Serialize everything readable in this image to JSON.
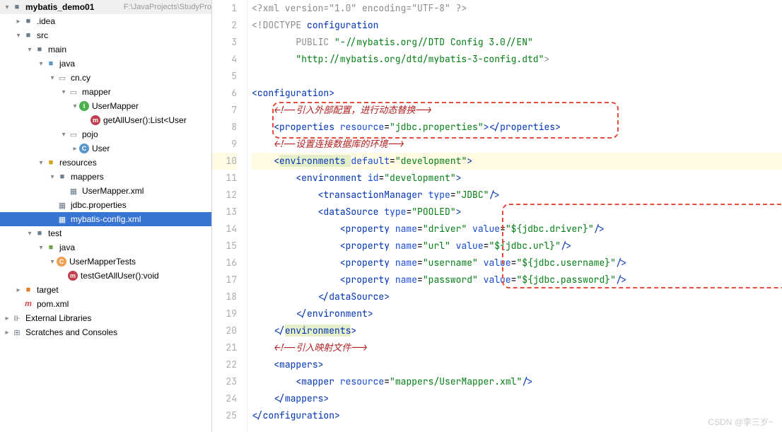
{
  "project": {
    "name": "mybatis_demo01",
    "path": "F:\\JavaProjects\\StudyPro"
  },
  "tree": {
    "idea": ".idea",
    "src": "src",
    "main": "main",
    "java_main": "java",
    "pkg_cn_cy": "cn.cy",
    "mapper": "mapper",
    "usermapper_if": "UserMapper",
    "getalluser": "getAllUser():List<User",
    "pojo": "pojo",
    "user_cls": "User",
    "resources": "resources",
    "mappers": "mappers",
    "usermapper_xml": "UserMapper.xml",
    "jdbc_props": "jdbc.properties",
    "mybatis_cfg": "mybatis-config.xml",
    "test": "test",
    "java_test": "java",
    "usermappertests": "UserMapperTests",
    "testgetalluser": "testGetAllUser():void",
    "target": "target",
    "pom": "pom.xml",
    "ext_libs": "External Libraries",
    "scratches": "Scratches and Consoles"
  },
  "code": {
    "l1": "<?xml version=\"1.0\" encoding=\"UTF-8\" ?>",
    "l2_a": "<!DOCTYPE ",
    "l2_b": "configuration",
    "l3_a": "PUBLIC ",
    "l3_b": "\"-//mybatis.org//DTD Config 3.0//EN\"",
    "l4_a": "\"http://mybatis.org/dtd/mybatis-3-config.dtd\"",
    "l4_b": ">",
    "l6_a": "<",
    "l6_b": "configuration",
    "l6_c": ">",
    "l7": "<!--引入外部配置，进行动态替换-->",
    "l8_a": "<",
    "l8_b": "properties ",
    "l8_c": "resource",
    "l8_d": "=",
    "l8_e": "\"jdbc.properties\"",
    "l8_f": "></",
    "l8_g": "properties",
    "l8_h": ">",
    "l9": "<!--设置连接数据库的环境-->",
    "l10_a": "<",
    "l10_b": "environments ",
    "l10_c": "default",
    "l10_d": "=",
    "l10_e": "\"development\"",
    "l10_f": ">",
    "l11_a": "<",
    "l11_b": "environment ",
    "l11_c": "id",
    "l11_d": "=",
    "l11_e": "\"development\"",
    "l11_f": ">",
    "l12_a": "<",
    "l12_b": "transactionManager ",
    "l12_c": "type",
    "l12_d": "=",
    "l12_e": "\"JDBC\"",
    "l12_f": "/>",
    "l13_a": "<",
    "l13_b": "dataSource ",
    "l13_c": "type",
    "l13_d": "=",
    "l13_e": "\"POOLED\"",
    "l13_f": ">",
    "l14_a": "<",
    "l14_b": "property ",
    "l14_c": "name",
    "l14_d": "=",
    "l14_e": "\"driver\" ",
    "l14_f": "value",
    "l14_g": "=",
    "l14_h": "\"${jdbc.driver}\"",
    "l14_i": "/>",
    "l15_a": "<",
    "l15_b": "property ",
    "l15_c": "name",
    "l15_d": "=",
    "l15_e": "\"url\" ",
    "l15_f": "value",
    "l15_g": "=",
    "l15_h": "\"${jdbc.url}\"",
    "l15_i": "/>",
    "l16_a": "<",
    "l16_b": "property ",
    "l16_c": "name",
    "l16_d": "=",
    "l16_e": "\"username\" ",
    "l16_f": "value",
    "l16_g": "=",
    "l16_h": "\"${jdbc.username}\"",
    "l16_i": "/>",
    "l17_a": "<",
    "l17_b": "property ",
    "l17_c": "name",
    "l17_d": "=",
    "l17_e": "\"password\" ",
    "l17_f": "value",
    "l17_g": "=",
    "l17_h": "\"${jdbc.password}\"",
    "l17_i": "/>",
    "l18_a": "</",
    "l18_b": "dataSource",
    "l18_c": ">",
    "l19_a": "</",
    "l19_b": "environment",
    "l19_c": ">",
    "l20_a": "</",
    "l20_b": "environments",
    "l20_c": ">",
    "l21": "<!--引入映射文件-->",
    "l22_a": "<",
    "l22_b": "mappers",
    "l22_c": ">",
    "l23_a": "<",
    "l23_b": "mapper ",
    "l23_c": "resource",
    "l23_d": "=",
    "l23_e": "\"mappers/UserMapper.xml\"",
    "l23_f": "/>",
    "l24_a": "</",
    "l24_b": "mappers",
    "l24_c": ">",
    "l25_a": "</",
    "l25_b": "configuration",
    "l25_c": ">"
  },
  "watermark": "CSDN @李三岁~"
}
